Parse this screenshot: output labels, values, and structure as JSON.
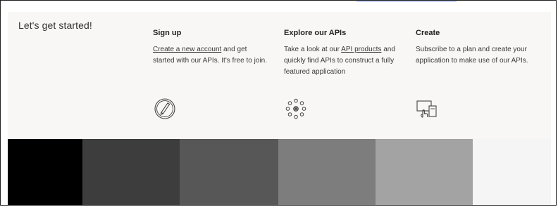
{
  "intro": {
    "lead_text": "Let's get started!"
  },
  "cards": [
    {
      "title": "Sign up",
      "link_text": "Create a new account",
      "text_after_link": " and get started with our APIs. It's free to join."
    },
    {
      "title": "Explore our APIs",
      "text_before_link": "Take a look at our ",
      "link_text": "API products",
      "text_after_link": " and quickly find APIs to construct a fully featured application"
    },
    {
      "title": "Create",
      "body": "Subscribe to a plan and create your application to make use of our APIs."
    }
  ],
  "icons": [
    "pencil-in-circle-icon",
    "burst-circle-icon",
    "touch-devices-icon"
  ],
  "colors": {
    "page_bg": "#ffffff",
    "panel_bg": "#f8f7f5",
    "accent": "#c8d2ff",
    "band_1": "#000000",
    "band_2": "#3d3d3d",
    "band_3": "#575757",
    "band_4": "#7d7d7d",
    "band_5": "#a3a3a3",
    "band_6": "#f5f5f5"
  }
}
